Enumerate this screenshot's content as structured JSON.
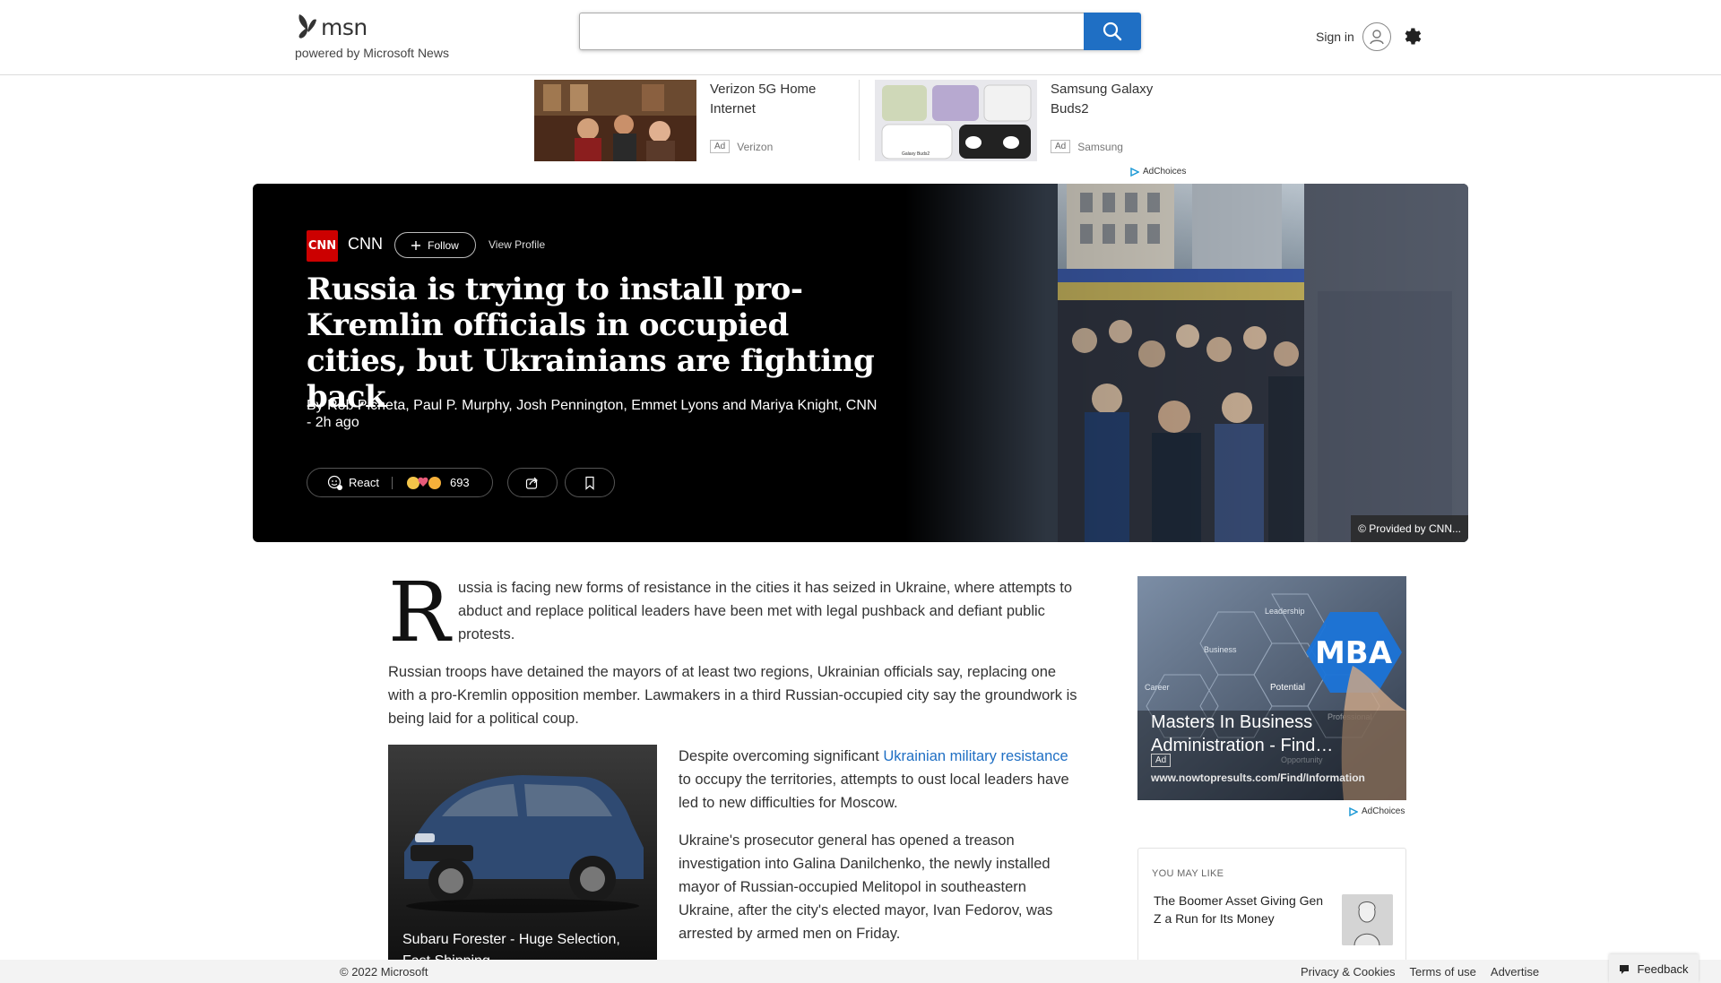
{
  "header": {
    "logo_text": "msn",
    "logo_sub": "powered by Microsoft News",
    "search_value": "",
    "signin_label": "Sign in"
  },
  "ads_top": [
    {
      "title": "Verizon 5G Home Internet",
      "badge": "Ad",
      "advertiser": "Verizon"
    },
    {
      "title": "Samsung Galaxy Buds2",
      "badge": "Ad",
      "advertiser": "Samsung",
      "image_caption": "Galaxy Buds2"
    }
  ],
  "adchoices_label": "AdChoices",
  "hero": {
    "source_logo": "CNN",
    "source_name": "CNN",
    "follow_label": "Follow",
    "view_profile_label": "View Profile",
    "title": "Russia is trying to install pro-Kremlin officials in occupied cities, but Ukrainians are fighting back",
    "byline": "By Rob Picheta, Paul P. Murphy, Josh Pennington, Emmet Lyons and Mariya Knight, CNN - 2h ago",
    "react_label": "React",
    "reaction_count": "693",
    "provided_by": "© Provided by CNN..."
  },
  "article": {
    "dropcap": "R",
    "p1": "ussia is facing new forms of resistance in the cities it has seized in Ukraine, where attempts to abduct and replace political leaders have been met with legal pushback and defiant public protests.",
    "p2": "Russian troops have detained the mayors of at least two regions, Ukrainian officials say, replacing one with a pro-Kremlin opposition member. Lawmakers in a third Russian-occupied city say the groundwork is being laid for a political coup.",
    "p3_before": "Despite overcoming significant ",
    "p3_link": "Ukrainian military resistance",
    "p3_after": " to occupy the territories, attempts to oust local leaders have led to new difficulties for Moscow.",
    "p4": "Ukraine's prosecutor general has opened a treason investigation into Galina Danilchenko, the newly installed mayor of Russian-occupied Melitopol in southeastern Ukraine, after the city's elected mayor, Ivan Fedorov, was arrested by armed men on Friday."
  },
  "car_ad": {
    "title": "Subaru Forester - Huge Selection, Fast Shipping"
  },
  "sidebar": {
    "mba_ad": {
      "title": "Masters In Business Administration - Find…",
      "badge": "Ad",
      "url": "www.nowtopresults.com/Find/Information",
      "image_words": {
        "mba": "MBA",
        "leadership": "Leadership",
        "business": "Business",
        "potential": "Potential",
        "career": "Career",
        "professional": "Professional",
        "opportunity": "Opportunity"
      }
    },
    "you_may_like": {
      "heading": "YOU MAY LIKE",
      "title": "The Boomer Asset Giving Gen Z a Run for Its Money"
    }
  },
  "footer": {
    "copyright": "© 2022 Microsoft",
    "links": [
      "Privacy & Cookies",
      "Terms of use",
      "Advertise"
    ],
    "feedback_label": "Feedback"
  },
  "colors": {
    "accent": "#1f6fc4",
    "cnn_red": "#cc0000",
    "hero_bg": "#000000"
  }
}
